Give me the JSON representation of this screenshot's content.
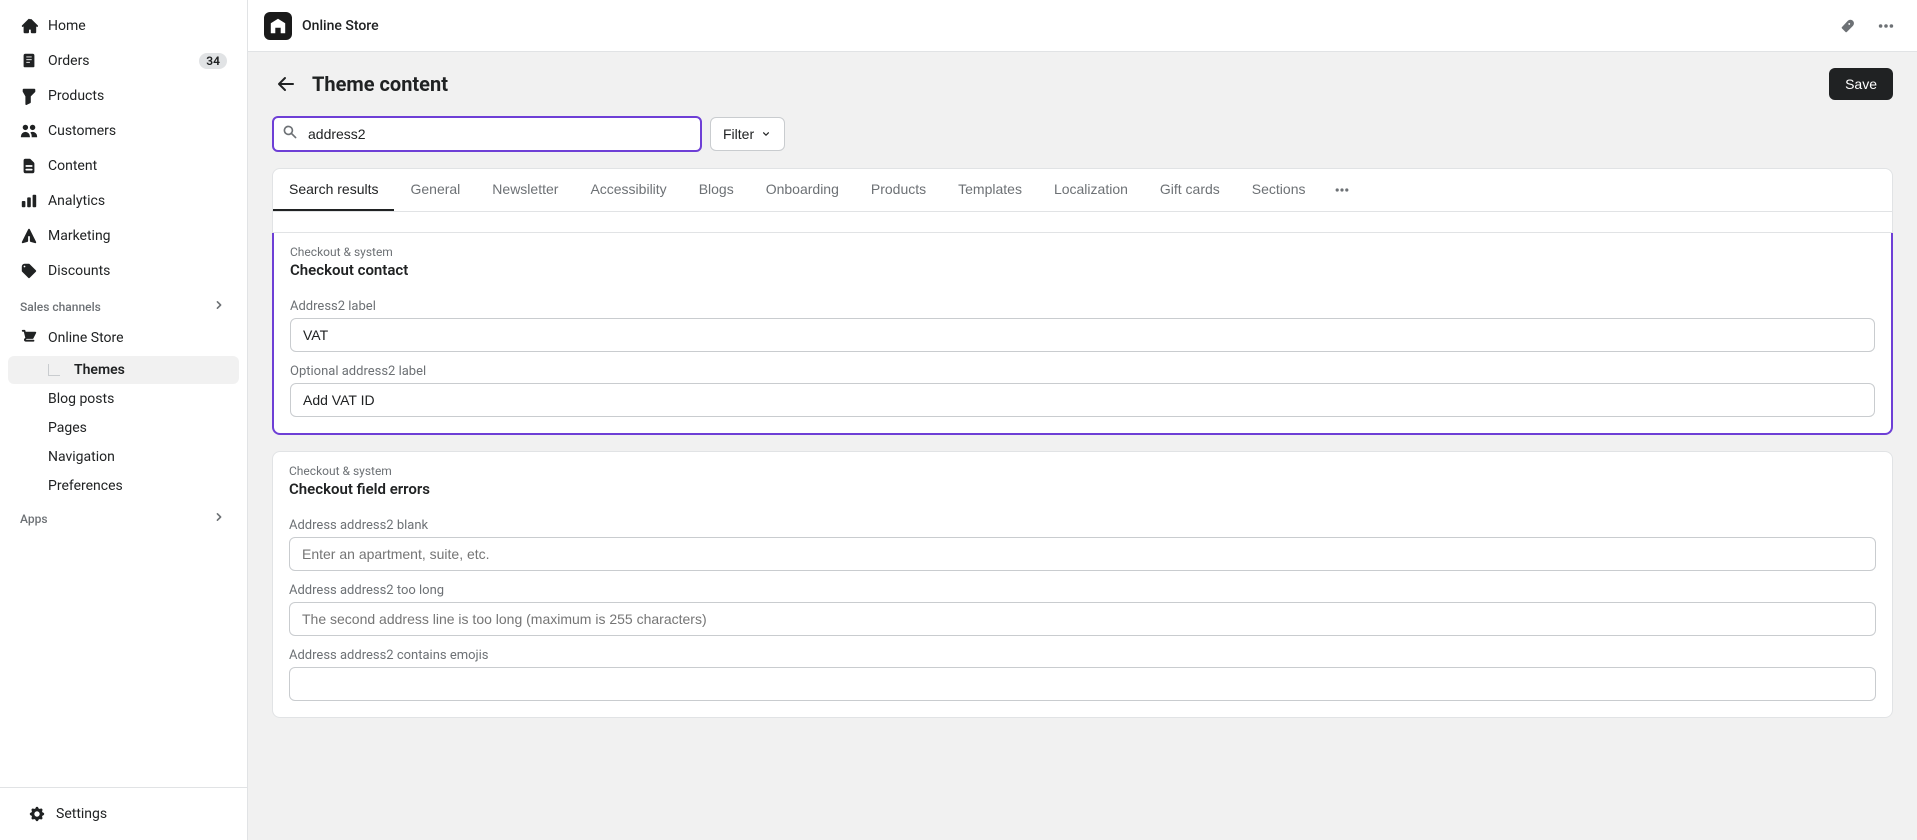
{
  "sidebar": {
    "nav_items": [
      {
        "id": "home",
        "label": "Home",
        "icon": "home"
      },
      {
        "id": "orders",
        "label": "Orders",
        "icon": "orders",
        "badge": "34"
      },
      {
        "id": "products",
        "label": "Products",
        "icon": "products"
      },
      {
        "id": "customers",
        "label": "Customers",
        "icon": "customers"
      },
      {
        "id": "content",
        "label": "Content",
        "icon": "content"
      },
      {
        "id": "analytics",
        "label": "Analytics",
        "icon": "analytics"
      },
      {
        "id": "marketing",
        "label": "Marketing",
        "icon": "marketing"
      },
      {
        "id": "discounts",
        "label": "Discounts",
        "icon": "discounts"
      }
    ],
    "sales_channels_label": "Sales channels",
    "sales_channels_items": [
      {
        "id": "online-store",
        "label": "Online Store",
        "icon": "store"
      }
    ],
    "online_store_sub": [
      {
        "id": "themes",
        "label": "Themes",
        "active": true
      },
      {
        "id": "blog-posts",
        "label": "Blog posts"
      },
      {
        "id": "pages",
        "label": "Pages"
      },
      {
        "id": "navigation",
        "label": "Navigation"
      },
      {
        "id": "preferences",
        "label": "Preferences"
      }
    ],
    "apps_label": "Apps",
    "settings_label": "Settings"
  },
  "topbar": {
    "logo_alt": "Online Store logo",
    "title": "Online Store",
    "pin_icon": "pin",
    "more_icon": "more"
  },
  "header": {
    "back_label": "←",
    "title": "Theme content",
    "save_label": "Save"
  },
  "search": {
    "placeholder": "address2",
    "value": "address2",
    "filter_label": "Filter"
  },
  "tabs": [
    {
      "id": "search-results",
      "label": "Search results",
      "active": true
    },
    {
      "id": "general",
      "label": "General"
    },
    {
      "id": "newsletter",
      "label": "Newsletter"
    },
    {
      "id": "accessibility",
      "label": "Accessibility"
    },
    {
      "id": "blogs",
      "label": "Blogs"
    },
    {
      "id": "onboarding",
      "label": "Onboarding"
    },
    {
      "id": "products",
      "label": "Products"
    },
    {
      "id": "templates",
      "label": "Templates"
    },
    {
      "id": "localization",
      "label": "Localization"
    },
    {
      "id": "gift-cards",
      "label": "Gift cards"
    },
    {
      "id": "sections",
      "label": "Sections"
    }
  ],
  "sections": [
    {
      "id": "checkout-contact",
      "section_label": "Checkout & system",
      "section_title": "Checkout contact",
      "highlighted": true,
      "fields": [
        {
          "id": "address2-label",
          "label": "Address2 label",
          "value": "VAT",
          "placeholder": ""
        },
        {
          "id": "optional-address2-label",
          "label": "Optional address2 label",
          "value": "Add VAT ID",
          "placeholder": ""
        }
      ]
    },
    {
      "id": "checkout-field-errors",
      "section_label": "Checkout & system",
      "section_title": "Checkout field errors",
      "highlighted": false,
      "fields": [
        {
          "id": "address-address2-blank",
          "label": "Address address2 blank",
          "value": "",
          "placeholder": "Enter an apartment, suite, etc."
        },
        {
          "id": "address-address2-too-long",
          "label": "Address address2 too long",
          "value": "",
          "placeholder": "The second address line is too long (maximum is 255 characters)"
        },
        {
          "id": "address-address2-contains-emojis",
          "label": "Address address2 contains emojis",
          "value": "",
          "placeholder": ""
        }
      ]
    }
  ]
}
